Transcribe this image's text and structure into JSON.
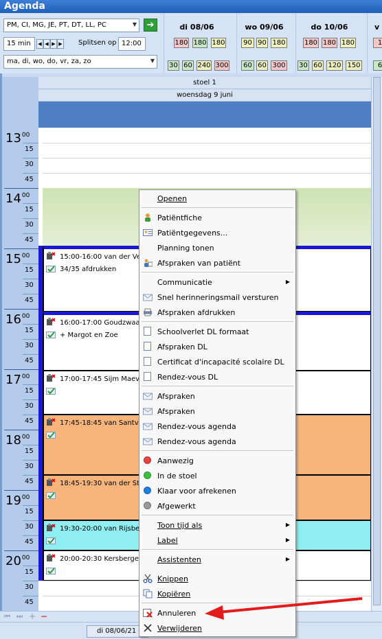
{
  "window": {
    "title": "Agenda"
  },
  "toolbar": {
    "groups_value": "PM, CI, MG, JE, PT, DT, LL, PC",
    "interval_value": "15 min",
    "split_label": "Splitsen op",
    "split_value": "12:00",
    "days_value": "ma, di, wo, do, vr, za, zo",
    "go_icon": "green-arrow-right-icon"
  },
  "days": [
    {
      "label": "di 08/06",
      "row1": [
        "180",
        "180",
        "180"
      ],
      "row2": [
        "30",
        "60",
        "240",
        "300"
      ]
    },
    {
      "label": "wo 09/06",
      "row1": [
        "90",
        "90",
        "180"
      ],
      "row2": [
        "60",
        "60",
        "300"
      ]
    },
    {
      "label": "do 10/06",
      "row1": [
        "180",
        "180",
        "180"
      ],
      "row2": [
        "30",
        "60",
        "120",
        "150"
      ]
    },
    {
      "label": "v",
      "row1": [
        "1"
      ],
      "row2": [
        "6"
      ]
    }
  ],
  "colors": {
    "pink": "#f4c8c8",
    "green": "#c9e8c8",
    "yellow": "#eef0c0",
    "orange": "#f8b57b",
    "cyan": "#8eeef2",
    "accent_blue": "#1a1ad6"
  },
  "calendar": {
    "chair": "stoel 1",
    "date": "woensdag 9 juni",
    "hours": [
      {
        "hour": "13",
        "sup": "00",
        "q": [
          "15",
          "30",
          "45"
        ]
      },
      {
        "hour": "14",
        "sup": "00",
        "q": [
          "15",
          "30",
          "45"
        ]
      },
      {
        "hour": "15",
        "sup": "00",
        "q": [
          "15",
          "30",
          "45"
        ]
      },
      {
        "hour": "16",
        "sup": "00",
        "q": [
          "15",
          "30",
          "45"
        ]
      },
      {
        "hour": "17",
        "sup": "00",
        "q": [
          "15",
          "30",
          "45"
        ]
      },
      {
        "hour": "18",
        "sup": "00",
        "q": [
          "15",
          "30",
          "45"
        ]
      },
      {
        "hour": "19",
        "sup": "00",
        "q": [
          "15",
          "30",
          "45"
        ]
      },
      {
        "hour": "20",
        "sup": "00",
        "q": [
          "15",
          "30",
          "45"
        ]
      }
    ],
    "appointments": [
      {
        "text": "15:00-16:00 van der Vee",
        "sub": "34/35 afdrukken",
        "color": "#ffffff"
      },
      {
        "text": "16:00-17:00 Goudzwaar",
        "sub": "+ Margot en Zoe",
        "color": "#ffffff"
      },
      {
        "text": "17:00-17:45 Sijm Maeve",
        "sub": "",
        "color": "#ffffff"
      },
      {
        "text": "17:45-18:45 van Santvo",
        "sub": "",
        "color": "#f8b57b"
      },
      {
        "text": "18:45-19:30 van der Sto",
        "sub": "",
        "color": "#f8b57b"
      },
      {
        "text": "19:30-20:00 van Rijsber",
        "sub": "",
        "color": "#8eeef2"
      },
      {
        "text": "20:00-20:30 Kersbergen",
        "sub": "",
        "color": "#ffffff"
      }
    ]
  },
  "statusbar": {
    "date": "di 08/06/21 -"
  },
  "menu": {
    "items": [
      {
        "label": "Openen",
        "icon": ""
      },
      {
        "label": "Patiëntfiche",
        "icon": "patient-icon"
      },
      {
        "label": "Patiëntgegevens...",
        "icon": "patient-card-icon"
      },
      {
        "label": "Planning tonen",
        "icon": ""
      },
      {
        "label": "Afspraken van patiënt",
        "icon": "patient-appointments-icon"
      },
      {
        "label": "Communicatie",
        "icon": ""
      },
      {
        "label": "Snel herinneringsmail versturen",
        "icon": "envelope-icon"
      },
      {
        "label": "Afspraken afdrukken",
        "icon": "printer-icon"
      },
      {
        "label": "Schoolverlet DL formaat",
        "icon": "document-icon"
      },
      {
        "label": "Afspraken DL",
        "icon": "document-icon"
      },
      {
        "label": "Certificat d'incapacité scolaire DL",
        "icon": "document-icon"
      },
      {
        "label": "Rendez-vous DL",
        "icon": "document-icon"
      },
      {
        "label": "Afspraken",
        "icon": "envelope-icon"
      },
      {
        "label": "Afspraken",
        "icon": "envelope-icon"
      },
      {
        "label": "Rendez-vous agenda",
        "icon": "envelope-icon"
      },
      {
        "label": "Rendez-vous agenda",
        "icon": "envelope-icon"
      },
      {
        "label": "Aanwezig",
        "icon": "red-dot-icon"
      },
      {
        "label": "In de stoel",
        "icon": "green-dot-icon"
      },
      {
        "label": "Klaar voor afrekenen",
        "icon": "blue-dot-icon"
      },
      {
        "label": "Afgewerkt",
        "icon": "gray-dot-icon"
      },
      {
        "label": "Toon tijd als",
        "icon": ""
      },
      {
        "label": "Label",
        "icon": ""
      },
      {
        "label": "Assistenten",
        "icon": ""
      },
      {
        "label": "Knippen",
        "icon": "scissors-icon"
      },
      {
        "label": "Kopiëren",
        "icon": "copy-icon"
      },
      {
        "label": "Annuleren",
        "icon": "cancel-appointment-icon"
      },
      {
        "label": "Verwijderen",
        "icon": "delete-x-icon"
      }
    ]
  }
}
